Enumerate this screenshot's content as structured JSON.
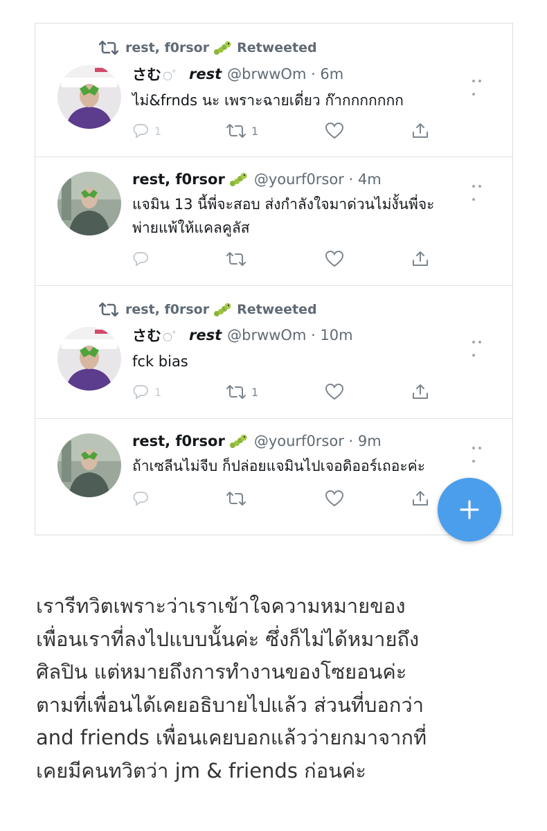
{
  "tweets": [
    {
      "retweet_line": {
        "user": "rest, f0rsor",
        "label": "Retweeted"
      },
      "name": "さむ",
      "name_emoji": "○゜",
      "name2": "rest",
      "handle": "@brwwOm · 6m",
      "text_lines": [
        "ไม่&frnds นะ เพราะฉายเดี่ยว ก๊ากกกกกกก"
      ],
      "reply_count": "1",
      "retweet_count": "1"
    },
    {
      "name": "rest, f0rsor",
      "handle": "@yourf0rsor · 4m",
      "text_lines": [
        "แจมิน 13 นี้พี่จะสอบ ส่งกำลังใจมาด่วนไม่งั้นพี่จะ",
        "พ่ายแพ้ให้แคลคูลัส"
      ]
    },
    {
      "retweet_line": {
        "user": "rest, f0rsor",
        "label": "Retweeted"
      },
      "name": "さむ",
      "name_emoji": "○゜",
      "name2": "rest",
      "handle": "@brwwOm · 10m",
      "text_lines": [
        "fck bias"
      ],
      "reply_count": "1",
      "retweet_count": "1"
    },
    {
      "name": "rest, f0rsor",
      "handle": "@yourf0rsor · 9m",
      "text_lines": [
        "ถ้าเซลีนไม่จีบ ก็ปล่อยแจมินไปเจอดิออร์เถอะค่ะ"
      ]
    }
  ],
  "fab_icon": "plus-icon",
  "caption_lines": [
    "เรารีทวิตเพราะว่าเราเข้าใจความหมายของ",
    "เพื่อนเราที่ลงไปแบบนั้นค่ะ ซึ่งก็ไม่ได้หมายถึง",
    "ศิลปิน แต่หมายถึงการทำงานของโซยอนค่ะ",
    "ตามที่เพื่อนได้เคยอธิบายไปแล้ว ส่วนที่บอกว่า",
    "and friends เพื่อนเคยบอกแล้วว่ายกมาจากที่",
    "เคยมีคนทวิตว่า jm & friends ก่อนค่ะ"
  ],
  "colors": {
    "accent": "#4a9eec",
    "icon_gray": "#7b858e",
    "border": "#d8dde1"
  }
}
